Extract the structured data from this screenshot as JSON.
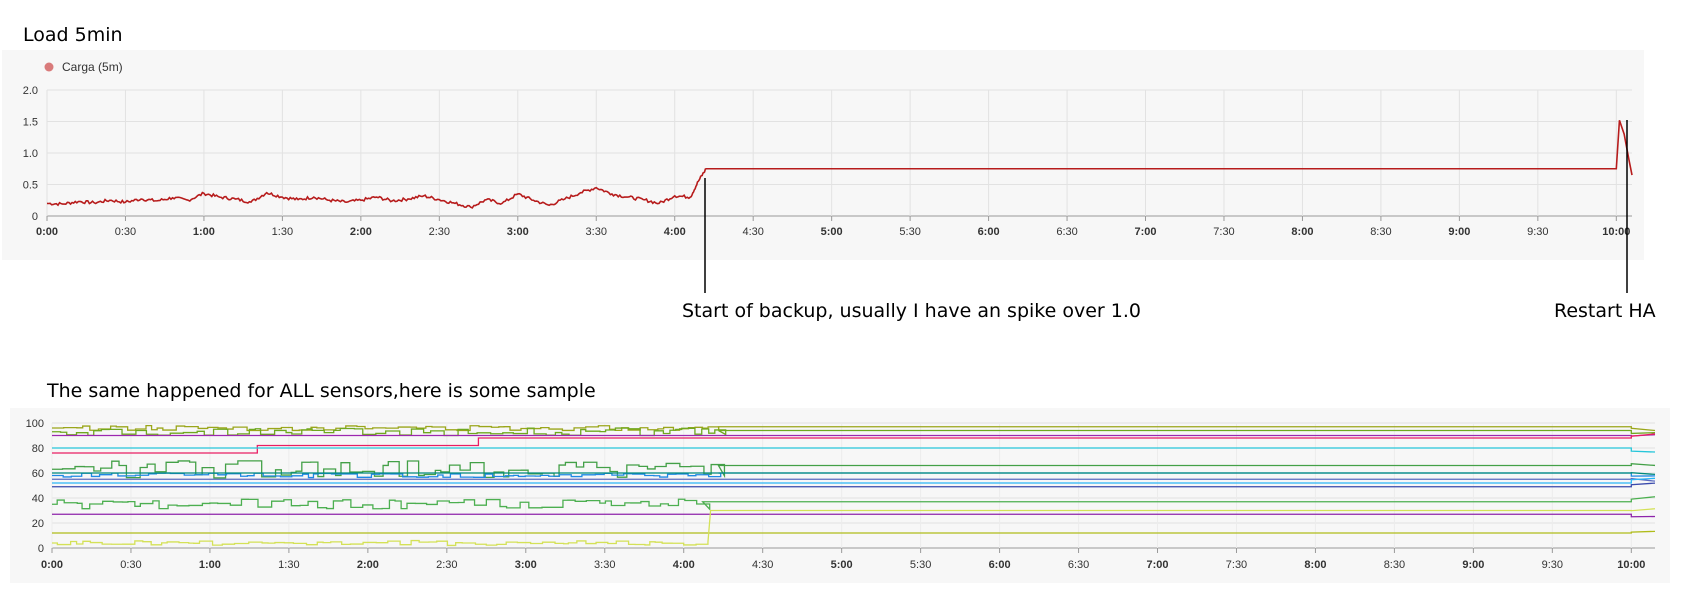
{
  "captions": {
    "top_title": "Load 5min",
    "backup_note": "Start of backup, usually I have an spike over 1.0",
    "restart_note": "Restart HA",
    "bottom_title": "The same happened for ALL sensors,here is some sample"
  },
  "chart_data": [
    {
      "type": "line",
      "title": "",
      "xlabel": "",
      "ylabel": "",
      "legend": {
        "placement": "top-left",
        "entries": [
          {
            "name": "Carga (5m)",
            "color": "#c0392b"
          }
        ]
      },
      "grid": true,
      "x_ticks": [
        "0:00",
        "0:30",
        "1:00",
        "1:30",
        "2:00",
        "2:30",
        "3:00",
        "3:30",
        "4:00",
        "4:30",
        "5:00",
        "5:30",
        "6:00",
        "6:30",
        "7:00",
        "7:30",
        "8:00",
        "8:30",
        "9:00",
        "9:30",
        "10:00"
      ],
      "x_range_hours": [
        0,
        10.1
      ],
      "y_ticks": [
        "0",
        "0.5",
        "1.0",
        "1.5",
        "2.0"
      ],
      "ylim": [
        0,
        2.0
      ],
      "series": [
        {
          "name": "Carga (5m)",
          "color": "#b71c1c",
          "points": [
            [
              0,
              0.2
            ],
            [
              0.1,
              0.19
            ],
            [
              0.2,
              0.23
            ],
            [
              0.3,
              0.21
            ],
            [
              0.4,
              0.25
            ],
            [
              0.5,
              0.22
            ],
            [
              0.6,
              0.27
            ],
            [
              0.7,
              0.24
            ],
            [
              0.8,
              0.29
            ],
            [
              0.9,
              0.25
            ],
            [
              1.0,
              0.36
            ],
            [
              1.1,
              0.3
            ],
            [
              1.2,
              0.27
            ],
            [
              1.3,
              0.22
            ],
            [
              1.4,
              0.37
            ],
            [
              1.5,
              0.3
            ],
            [
              1.6,
              0.26
            ],
            [
              1.7,
              0.3
            ],
            [
              1.8,
              0.25
            ],
            [
              1.9,
              0.22
            ],
            [
              2.0,
              0.25
            ],
            [
              2.1,
              0.3
            ],
            [
              2.2,
              0.24
            ],
            [
              2.3,
              0.27
            ],
            [
              2.4,
              0.32
            ],
            [
              2.5,
              0.26
            ],
            [
              2.6,
              0.2
            ],
            [
              2.7,
              0.14
            ],
            [
              2.8,
              0.26
            ],
            [
              2.9,
              0.2
            ],
            [
              3.0,
              0.35
            ],
            [
              3.1,
              0.25
            ],
            [
              3.2,
              0.17
            ],
            [
              3.3,
              0.27
            ],
            [
              3.4,
              0.37
            ],
            [
              3.5,
              0.45
            ],
            [
              3.6,
              0.35
            ],
            [
              3.7,
              0.3
            ],
            [
              3.8,
              0.26
            ],
            [
              3.9,
              0.2
            ],
            [
              4.0,
              0.32
            ],
            [
              4.1,
              0.3
            ],
            [
              4.15,
              0.55
            ],
            [
              4.2,
              0.75
            ],
            [
              9.95,
              0.75
            ],
            [
              10.0,
              0.75
            ],
            [
              10.02,
              1.52
            ],
            [
              10.05,
              1.3
            ],
            [
              10.08,
              0.9
            ],
            [
              10.1,
              0.65
            ]
          ]
        }
      ]
    },
    {
      "type": "line",
      "title": "",
      "xlabel": "",
      "ylabel": "",
      "grid": true,
      "x_ticks": [
        "0:00",
        "0:30",
        "1:00",
        "1:30",
        "2:00",
        "2:30",
        "3:00",
        "3:30",
        "4:00",
        "4:30",
        "5:00",
        "5:30",
        "6:00",
        "6:30",
        "7:00",
        "7:30",
        "8:00",
        "8:30",
        "9:00",
        "9:30",
        "10:00"
      ],
      "x_range_hours": [
        0,
        10.15
      ],
      "y_ticks": [
        "0",
        "20",
        "40",
        "60",
        "80",
        "100"
      ],
      "ylim": [
        0,
        100
      ],
      "series": [
        {
          "color": "#9aa61a",
          "level": 96,
          "noise": 2,
          "noisy_until": 4.2,
          "after": 97
        },
        {
          "color": "#6fa81f",
          "level": 93,
          "noise": 3,
          "noisy_until": 4.2,
          "after": 94
        },
        {
          "color": "#9c27b0",
          "level": 90,
          "noise": 0,
          "noisy_until": 0,
          "after": 91
        },
        {
          "color": "#e91e63",
          "level": 76,
          "step": [
            [
              0.9,
              76
            ],
            [
              1.3,
              82
            ],
            [
              2.7,
              88
            ]
          ],
          "noise": 0,
          "noisy_until": 0,
          "after": 88
        },
        {
          "color": "#26c6da",
          "level": 80,
          "noise": 0,
          "noisy_until": 0,
          "after": 80
        },
        {
          "color": "#43a047",
          "level": 63,
          "noise": 7,
          "noisy_until": 4.2,
          "after": 66
        },
        {
          "color": "#1e88e5",
          "level": 58,
          "noise": 2,
          "noisy_until": 4.2,
          "after": 60
        },
        {
          "color": "#00897b",
          "level": 60,
          "noise": 1,
          "noisy_until": 0,
          "after": 62
        },
        {
          "color": "#5c6bc0",
          "level": 55,
          "noise": 0,
          "noisy_until": 0,
          "after": 56
        },
        {
          "color": "#29b6f6",
          "level": 52,
          "noise": 0,
          "noisy_until": 0,
          "after": 52
        },
        {
          "color": "#3949ab",
          "level": 49,
          "noise": 0,
          "noisy_until": 0,
          "after": 49
        },
        {
          "color": "#4caf50",
          "level": 35,
          "noise": 4,
          "noisy_until": 4.1,
          "after": 37
        },
        {
          "color": "#8e24aa",
          "level": 27,
          "noise": 0,
          "noisy_until": 0,
          "after": 27
        },
        {
          "color": "#b0bc1a",
          "level": 12,
          "noise": 0,
          "noisy_until": 0,
          "after": 12
        },
        {
          "color": "#d4e157",
          "level": 4,
          "noise": 2,
          "noisy_until": 4.15,
          "after": 30
        }
      ]
    }
  ]
}
